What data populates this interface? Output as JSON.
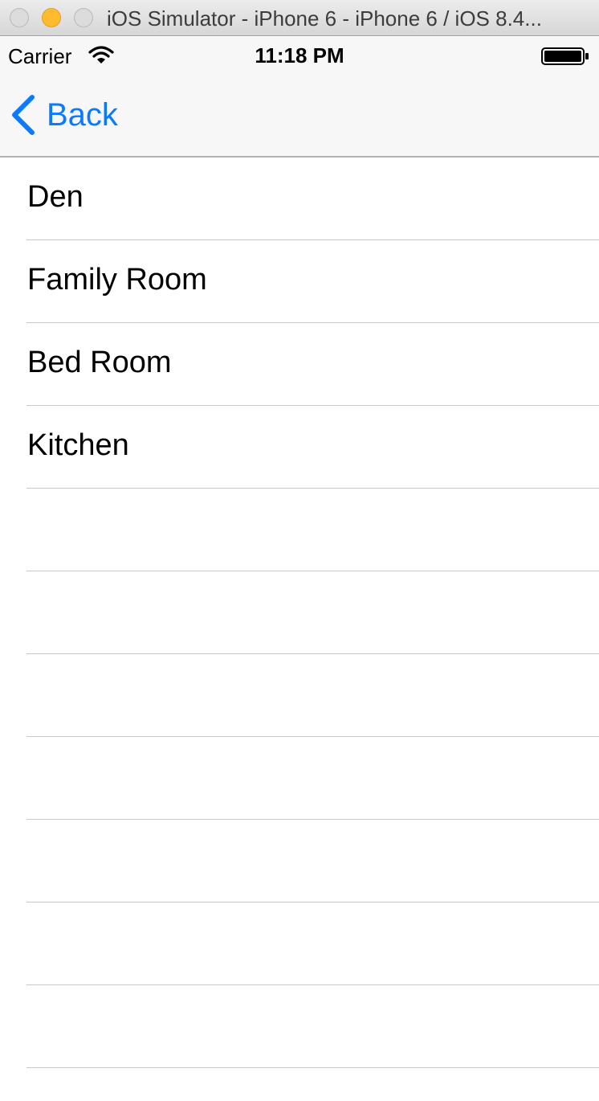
{
  "window": {
    "title": "iOS Simulator - iPhone 6 - iPhone 6 / iOS 8.4..."
  },
  "status_bar": {
    "carrier": "Carrier",
    "time": "11:18 PM",
    "icons": [
      "wifi-icon",
      "battery-icon"
    ]
  },
  "nav_bar": {
    "back_label": "Back",
    "back_icon": "chevron-left-icon",
    "tint_color": "#0A7AFE"
  },
  "table": {
    "rows": [
      {
        "label": "Den"
      },
      {
        "label": "Family Room"
      },
      {
        "label": "Bed Room"
      },
      {
        "label": "Kitchen"
      },
      {
        "label": ""
      },
      {
        "label": ""
      },
      {
        "label": ""
      },
      {
        "label": ""
      },
      {
        "label": ""
      },
      {
        "label": ""
      },
      {
        "label": ""
      }
    ]
  }
}
